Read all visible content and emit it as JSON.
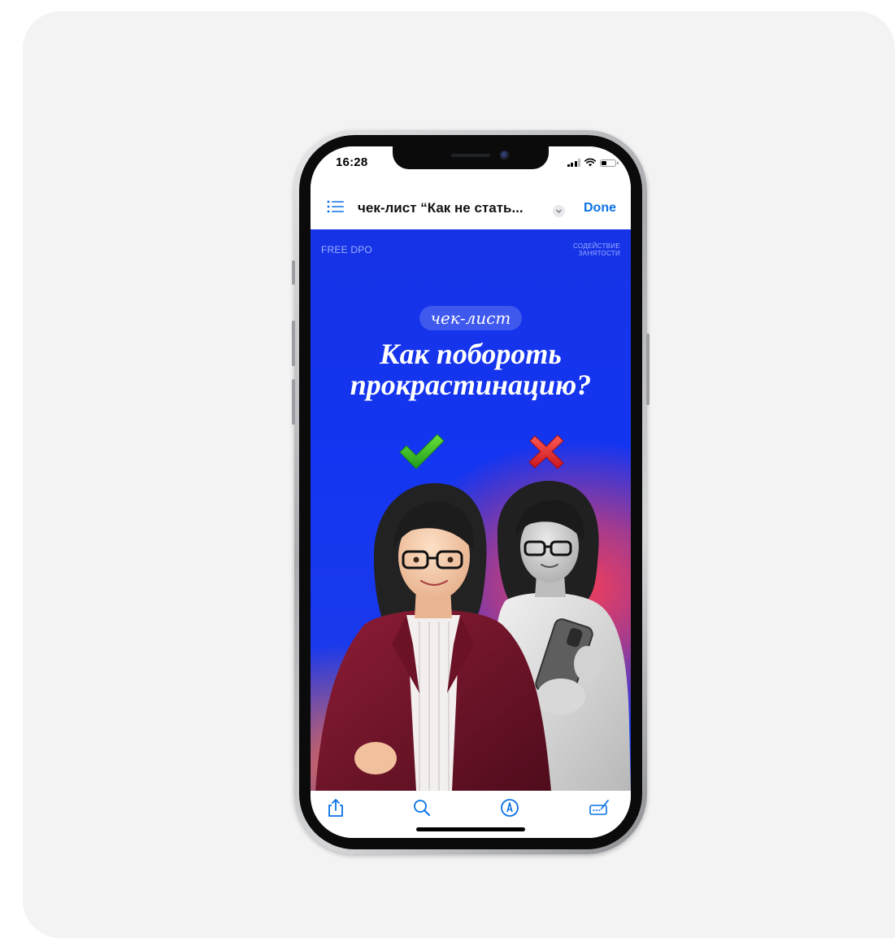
{
  "status_bar": {
    "time": "16:28",
    "icons": [
      "signal-icon",
      "wifi-icon",
      "battery-icon"
    ]
  },
  "nav_bar": {
    "list_icon": "list-icon",
    "document_title": "чек-лист “Как не стать...",
    "chevron_icon": "chevron-down-icon",
    "done_label": "Done",
    "accent_color": "#0a72e6"
  },
  "document": {
    "brand_left": "FREE DPO",
    "brand_right_line1": "СОДЕЙСТВИЕ",
    "brand_right_line2": "ЗАНЯТОСТИ",
    "pill_label": "чек-лист",
    "headline_line1": "Как побороть",
    "headline_line2": "прокрастинацию?",
    "illustration": {
      "check_icon": "green-check-icon",
      "cross_icon": "red-cross-icon",
      "figures": [
        "woman-in-burgundy-blazer",
        "woman-with-phone-greyscale"
      ]
    },
    "colors": {
      "background": "#1435f1",
      "accent_warm": "#ff3e50",
      "check": "#3fcf2f",
      "cross": "#e8242c"
    }
  },
  "toolbar": {
    "items": [
      "share-icon",
      "search-icon",
      "markup-icon",
      "signature-icon"
    ],
    "tint": "#0a72e6"
  }
}
